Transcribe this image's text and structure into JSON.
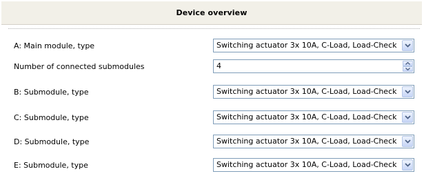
{
  "header": {
    "title": "Device overview"
  },
  "rows": [
    {
      "label": "A: Main module, type",
      "control": "dropdown",
      "value": "Switching actuator 3x 10A, C-Load, Load-Check"
    },
    {
      "label": "Number of connected submodules",
      "control": "spinner",
      "value": "4"
    },
    {
      "label": "B: Submodule, type",
      "control": "dropdown",
      "value": "Switching actuator 3x 10A, C-Load, Load-Check"
    },
    {
      "label": "C: Submodule, type",
      "control": "dropdown",
      "value": "Switching actuator 3x 10A, C-Load, Load-Check"
    },
    {
      "label": "D: Submodule, type",
      "control": "dropdown",
      "value": "Switching actuator 3x 10A, C-Load, Load-Check"
    },
    {
      "label": "E: Submodule, type",
      "control": "dropdown",
      "value": "Switching actuator 3x 10A, C-Load, Load-Check"
    }
  ],
  "icons": {
    "dropdown": "chevron-down-icon",
    "spin_up": "arrow-up-icon",
    "spin_down": "arrow-down-icon"
  },
  "colors": {
    "header_background": "#f2f0e8",
    "control_border": "#7f9db9",
    "button_arrow": "#4d6185"
  }
}
